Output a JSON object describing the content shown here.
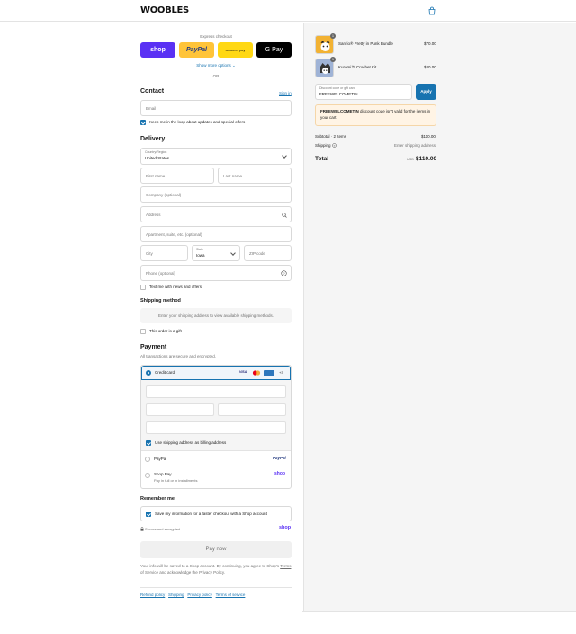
{
  "header": {
    "logo": "WOOBLES",
    "cart_icon": "shopping-bag-icon"
  },
  "express": {
    "title": "Express checkout",
    "buttons": [
      {
        "label": "shop",
        "color": "#5a31f4"
      },
      {
        "label": "PayPal",
        "color": "#ffc439"
      },
      {
        "label": "amazon pay",
        "color": "#ffd814"
      },
      {
        "label": "G Pay",
        "color": "#000000"
      }
    ],
    "more": "Show more options",
    "or": "OR"
  },
  "contact": {
    "title": "Contact",
    "sign_in": "Sign in",
    "email_placeholder": "Email",
    "keep_loop": "Keep me in the loop about updates and special offers"
  },
  "delivery": {
    "title": "Delivery",
    "country_label": "Country/Region",
    "country_value": "United States",
    "first_name": "First name",
    "last_name": "Last name",
    "company": "Company (optional)",
    "address": "Address",
    "apartment": "Apartment, suite, etc. (optional)",
    "city": "City",
    "state_label": "State",
    "state_value": "Iowa",
    "zip": "ZIP code",
    "phone": "Phone (optional)",
    "text_me": "Text me with news and offers"
  },
  "shipping_method": {
    "title": "Shipping method",
    "note": "Enter your shipping address to view available shipping methods.",
    "gift": "This order is a gift"
  },
  "payment": {
    "title": "Payment",
    "subtitle": "All transactions are secure and encrypted.",
    "credit_card": "Credit card",
    "more_cards": "+3",
    "use_shipping": "Use shipping address as billing address",
    "paypal": "PayPal",
    "paypal_logo": "PayPal",
    "shop_pay": "Shop Pay",
    "shop_pay_sub": "Pay in full or in installments",
    "shop_logo": "shop"
  },
  "remember": {
    "title": "Remember me",
    "save_info": "Save my information for a faster checkout with a Shop account",
    "secure": "Secure and encrypted",
    "shop_logo": "shop"
  },
  "pay_now": "Pay now",
  "legal": {
    "text1": "Your info will be saved to a Shop account. By continuing, you agree to Shop's",
    "terms": "Terms of Service",
    "and": "and acknowledge the",
    "privacy": "Privacy Policy",
    "period": "."
  },
  "footer_links": [
    "Refund policy",
    "Shipping",
    "Privacy policy",
    "Terms of service"
  ],
  "summary": {
    "items": [
      {
        "name": "Sanrio® Pretty in Punk Bundle",
        "price": "$70.00",
        "qty": "1"
      },
      {
        "name": "Kuromi™ Crochet Kit",
        "price": "$40.00",
        "qty": "1"
      }
    ],
    "discount_label": "Discount code or gift card",
    "discount_value": "FREEWELCOMETIN",
    "apply": "Apply",
    "error_code": "FREEWELCOMETIN",
    "error_text": "discount code isn't valid for the items in your cart",
    "subtotal_label": "Subtotal · 2 items",
    "subtotal_value": "$110.00",
    "shipping_label": "Shipping",
    "shipping_value": "Enter shipping address",
    "total_label": "Total",
    "currency": "USD",
    "total_value": "$110.00"
  }
}
